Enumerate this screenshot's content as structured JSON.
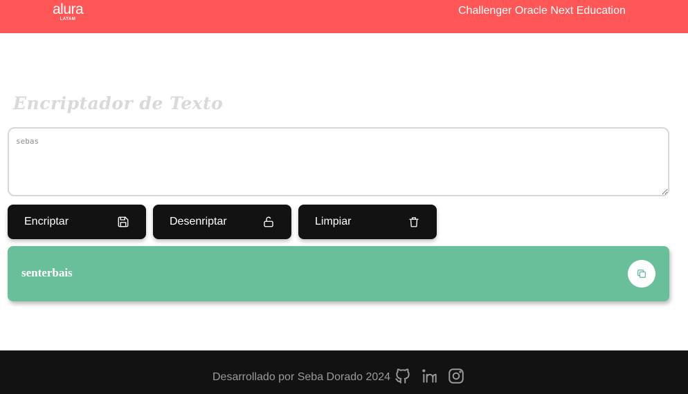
{
  "header": {
    "logo_main": "alura",
    "logo_sub": "LATAM",
    "title": "Challenger Oracle Next Education",
    "background": "#ff5757"
  },
  "main": {
    "title": "Encriptador de Texto",
    "input_value": "sebas",
    "buttons": [
      {
        "label": "Encriptar",
        "icon": "save-icon"
      },
      {
        "label": "Desenriptar",
        "icon": "unlock-icon"
      },
      {
        "label": "Limpiar",
        "icon": "trash-icon"
      }
    ],
    "result_text": "senterbais",
    "result_background": "#68bf9a",
    "copy_icon": "copy-icon"
  },
  "footer": {
    "text": "Desarrollado por Seba Dorado 2024",
    "icons": [
      "github-icon",
      "linkedin-icon",
      "instagram-icon"
    ],
    "background": "#121212"
  }
}
